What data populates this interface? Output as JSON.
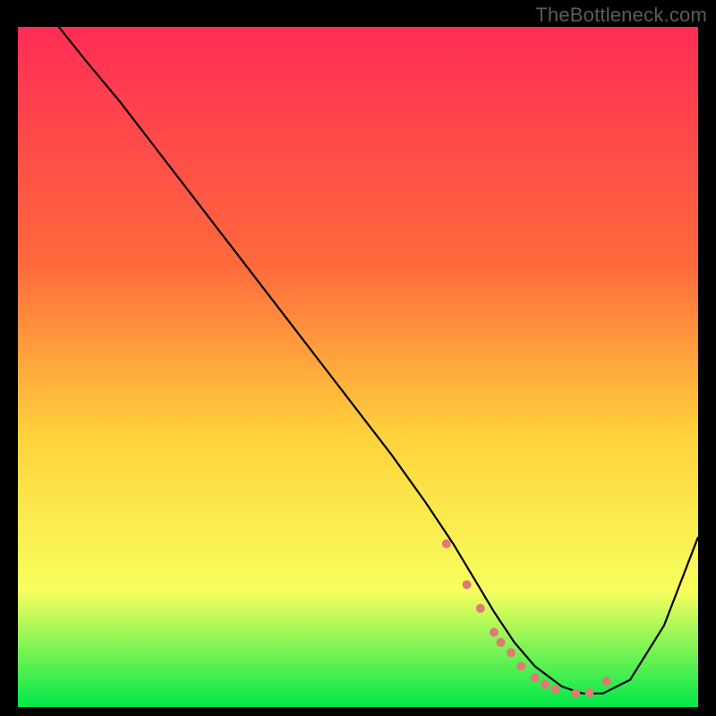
{
  "watermark": "TheBottleneck.com",
  "colors": {
    "bg": "#000000",
    "grad_top": "#ff2d55",
    "grad_mid1": "#ff6a3c",
    "grad_mid2": "#ffd23c",
    "grad_mid3": "#f7ff5e",
    "grad_bot": "#00e84a",
    "curve": "#000000",
    "dots": "#e07a74",
    "watermark": "#5c5c5c"
  },
  "chart_data": {
    "type": "line",
    "title": "",
    "xlabel": "",
    "ylabel": "",
    "xlim": [
      0,
      100
    ],
    "ylim": [
      0,
      100
    ],
    "annotations": [],
    "series": [
      {
        "name": "bottleneck-curve",
        "x": [
          6,
          10,
          15,
          20,
          25,
          30,
          35,
          40,
          45,
          50,
          55,
          60,
          64,
          67,
          70,
          73,
          76,
          80,
          83,
          86,
          90,
          95,
          100
        ],
        "values": [
          100,
          95,
          89,
          82.5,
          76,
          69.5,
          63,
          56.5,
          50,
          43.5,
          37,
          30,
          24,
          19,
          14,
          9.5,
          6,
          3,
          2,
          2,
          4,
          12,
          25
        ]
      }
    ],
    "points": {
      "name": "highlight-dots",
      "x": [
        63,
        66,
        68,
        70,
        71,
        72.5,
        74,
        76,
        77.5,
        79,
        82,
        84,
        86.5
      ],
      "values": [
        24,
        18,
        14.5,
        11,
        9.5,
        8,
        6,
        4.3,
        3.3,
        2.6,
        2,
        2.1,
        3.8
      ]
    }
  }
}
